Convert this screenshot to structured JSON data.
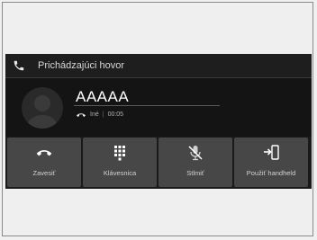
{
  "header": {
    "title": "Prichádzajúci hovor"
  },
  "caller": {
    "name": "AAAAA",
    "number_type": "Iné",
    "duration": "00:05"
  },
  "buttons": [
    {
      "label": "Zavesiť",
      "icon": "hang-up-icon"
    },
    {
      "label": "Klávesnica",
      "icon": "keypad-icon"
    },
    {
      "label": "Stlmiť",
      "icon": "mute-microphone-icon"
    },
    {
      "label": "Použiť handheld",
      "icon": "transfer-to-handset-icon"
    }
  ]
}
